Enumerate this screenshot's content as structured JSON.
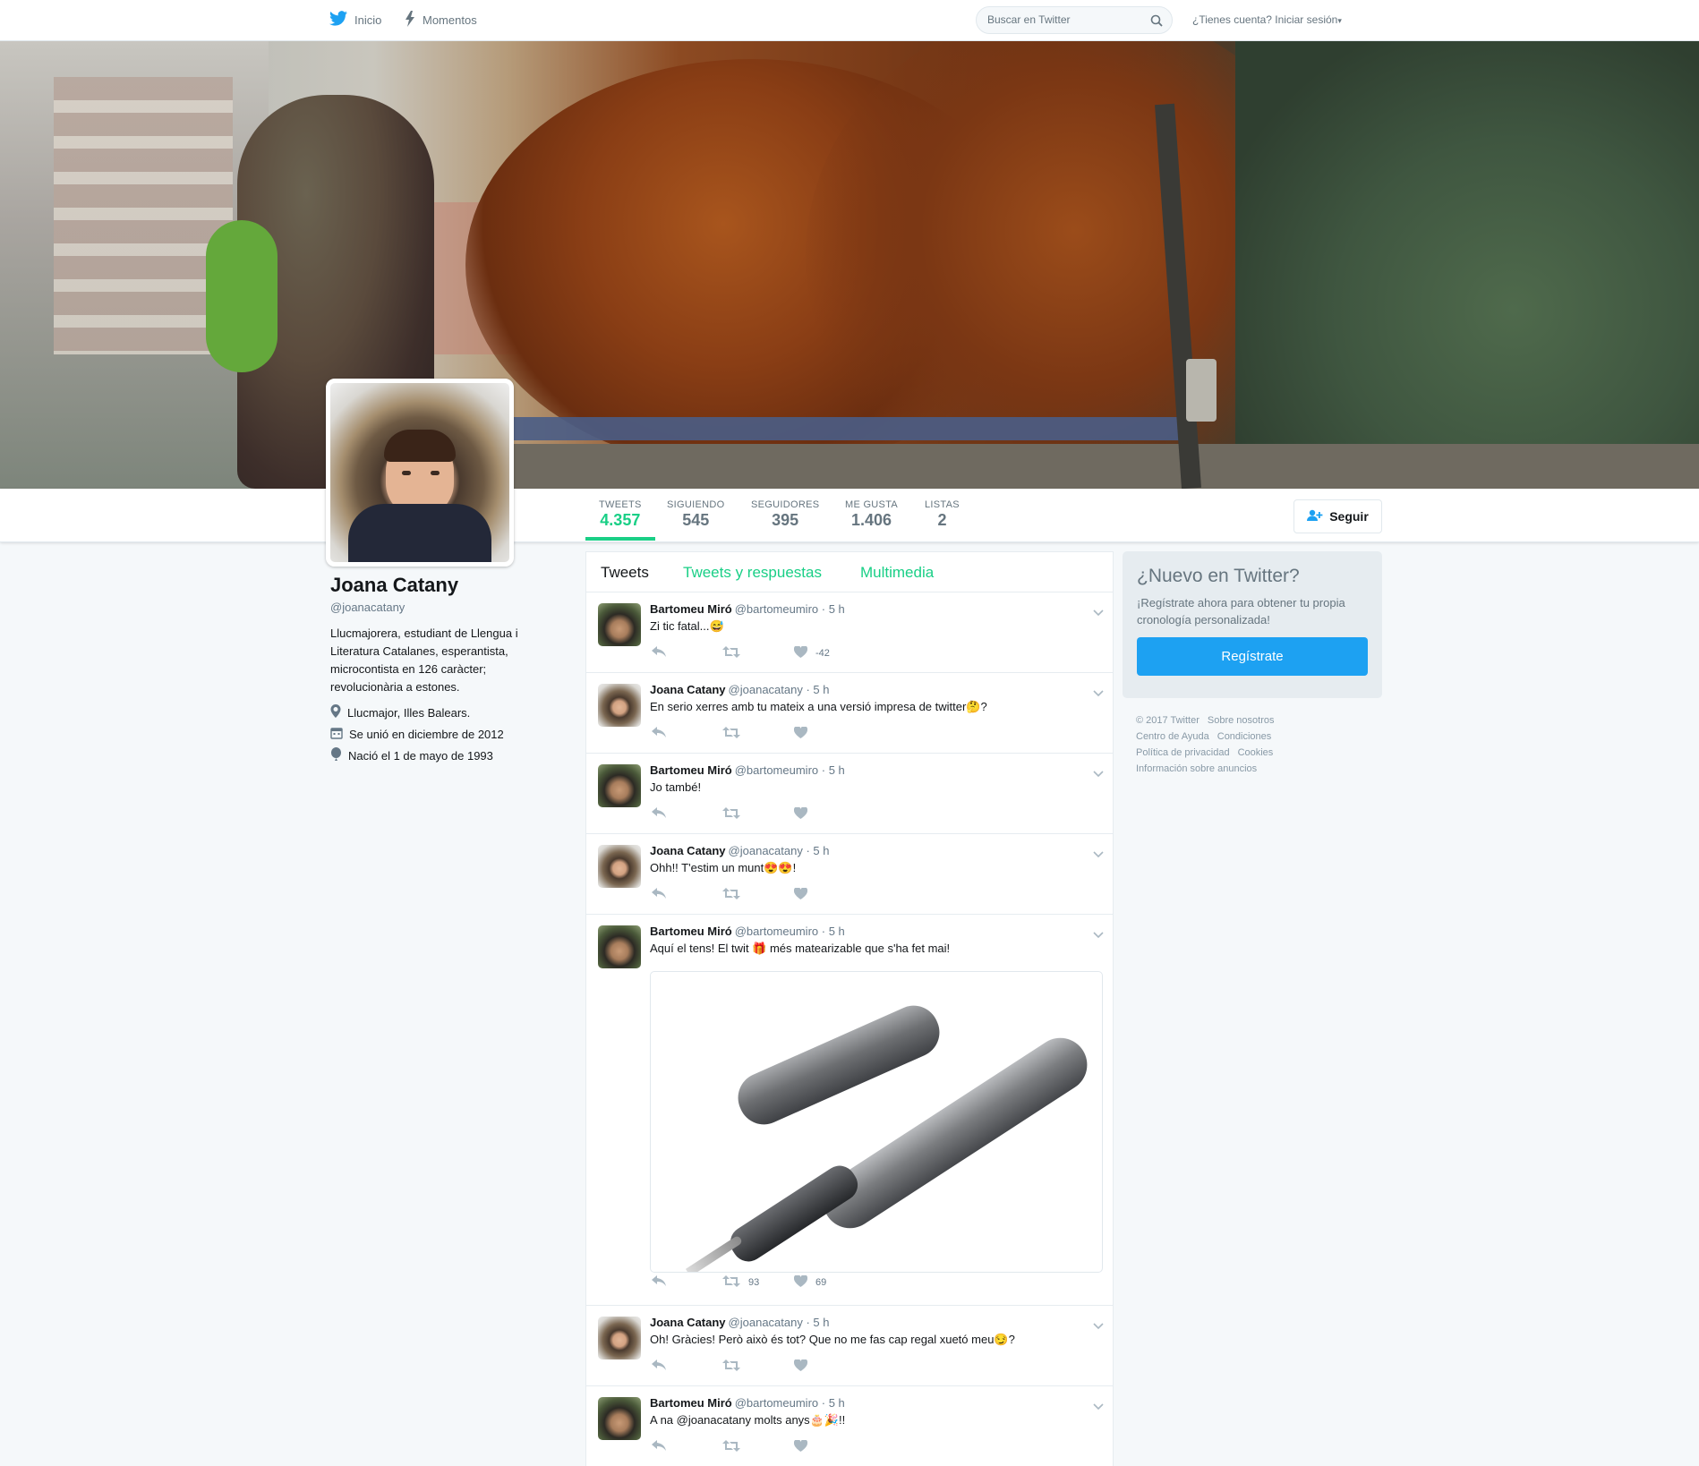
{
  "nav": {
    "home_label": "Inicio",
    "moments_label": "Momentos",
    "search_placeholder": "Buscar en Twitter",
    "login_prompt": "¿Tienes cuenta?",
    "login_link": "Iniciar sesión"
  },
  "stats": [
    {
      "label": "TWEETS",
      "value": "4.357"
    },
    {
      "label": "SIGUIENDO",
      "value": "545"
    },
    {
      "label": "SEGUIDORES",
      "value": "395"
    },
    {
      "label": "ME GUSTA",
      "value": "1.406"
    },
    {
      "label": "LISTAS",
      "value": "2"
    }
  ],
  "follow_label": "Seguir",
  "profile": {
    "name": "Joana Catany",
    "handle": "@joanacatany",
    "bio": "Llucmajorera, estudiant de Llengua i Literatura Catalanes, esperantista, microcontista en 126 caràcter; revolucionària a estones.",
    "location": "Llucmajor, Illes Balears.",
    "joined": "Se unió en diciembre de 2012",
    "born": "Nació el 1 de mayo de 1993"
  },
  "tabs": [
    "Tweets",
    "Tweets y respuestas",
    "Multimedia"
  ],
  "tweets": [
    {
      "name": "Bartomeu Miró",
      "handle": "@bartomeumiro",
      "time": "· 5 h",
      "text": "Zi tic fatal...😅",
      "retweets": "",
      "likes": "-42"
    },
    {
      "name": "Joana Catany",
      "handle": "@joanacatany",
      "time": "· 5 h",
      "text": "En serio xerres amb tu mateix a una versió impresa de twitter🤔?",
      "retweets": "",
      "likes": ""
    },
    {
      "name": "Bartomeu Miró",
      "handle": "@bartomeumiro",
      "time": "· 5 h",
      "text": "Jo també!",
      "retweets": "",
      "likes": ""
    },
    {
      "name": "Joana Catany",
      "handle": "@joanacatany",
      "time": "· 5 h",
      "text": "Ohh!! T'estim un munt😍😍!",
      "retweets": "",
      "likes": ""
    },
    {
      "name": "Bartomeu Miró",
      "handle": "@bartomeumiro",
      "time": "· 5 h",
      "text": "Aquí el tens! El twit 🎁 més matearizable que s'ha fet mai!",
      "retweets": "93",
      "likes": "69"
    },
    {
      "name": "Joana Catany",
      "handle": "@joanacatany",
      "time": "· 5 h",
      "text": "Oh! Gràcies! Però això és tot? Que no me fas cap regal xuetó meu😏?",
      "retweets": "",
      "likes": ""
    },
    {
      "name": "Bartomeu Miró",
      "handle": "@bartomeumiro",
      "time": "· 5 h",
      "text": "A na @joanacatany molts anys🎂🎉!!",
      "retweets": "",
      "likes": ""
    }
  ],
  "signup": {
    "title": "¿Nuevo en Twitter?",
    "text": "¡Regístrate ahora para obtener tu propia cronología personalizada!",
    "button": "Regístrate"
  },
  "footer": [
    "© 2017 Twitter",
    "Sobre nosotros",
    "Centro de Ayuda",
    "Condiciones",
    "Política de privacidad",
    "Cookies",
    "Información sobre anuncios"
  ],
  "colors": {
    "accent": "#19cf86",
    "twitter_blue": "#1da1f2"
  }
}
